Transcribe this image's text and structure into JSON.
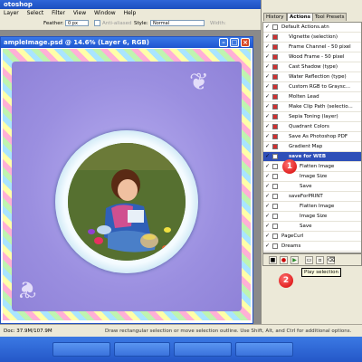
{
  "app": {
    "title": "otoshop"
  },
  "menu": [
    "Layer",
    "Select",
    "Filter",
    "View",
    "Window",
    "Help"
  ],
  "options": {
    "feather_label": "Feather:",
    "feather_value": "0 px",
    "antialiased_label": "Anti-aliased",
    "style_label": "Style:",
    "style_value": "Normal",
    "width_label": "Width:"
  },
  "document": {
    "title": "ampleImage.psd @ 14.6% (Layer 6, RGB)"
  },
  "panel": {
    "tabs": [
      "History",
      "Actions",
      "Tool Presets"
    ],
    "active_tab": "Actions",
    "actions": [
      "Default Actions.atn",
      "Vignette (selection)",
      "Frame Channel - 50 pixel",
      "Wood Frame - 50 pixel",
      "Cast Shadow (type)",
      "Water Reflection (type)",
      "Custom RGB to Graysc...",
      "Molten Lead",
      "Make Clip Path (selectio...",
      "Sepia Toning (layer)",
      "Quadrant Colors",
      "Save As Photoshop PDF",
      "Gradient Map",
      "save for WEB",
      "Flatten Image",
      "Image Size",
      "Save",
      "saveForPRINT",
      "Flatten Image",
      "Image Size",
      "Save",
      "PageCurl",
      "Dreams"
    ],
    "tooltip": "Play selection"
  },
  "markers": [
    "1",
    "2"
  ],
  "status": {
    "doc": "Doc: 37.9M/107.9M",
    "hint": "Draw rectangular selection or move selection outline. Use Shift, Alt, and Ctrl for additional options."
  },
  "taskbar": [
    "",
    "",
    "",
    ""
  ]
}
